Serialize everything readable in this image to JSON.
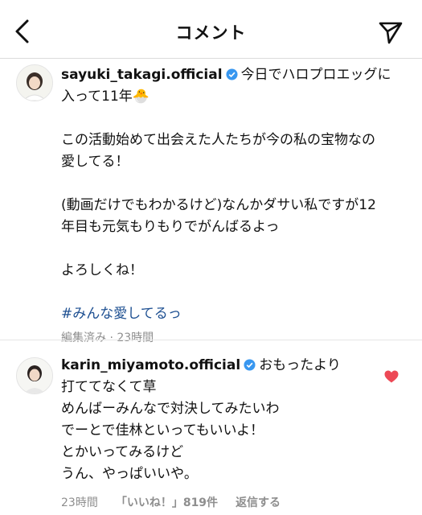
{
  "header": {
    "title": "コメント",
    "back_icon": "chevron-left-icon",
    "send_icon": "paper-plane-icon"
  },
  "comments": [
    {
      "username": "sayuki_takagi.official",
      "verified": true,
      "lines": [
        "今日でハロプロエッグに",
        "入って11年",
        "この活動始めて出会えた人たちが今の私の宝物なの",
        "愛してる！",
        "(動画だけでもわかるけど)なんかダサい私ですが12",
        "年目も元気もりもりでがんばるよっ",
        "よろしくね！"
      ],
      "emoji": "🐣",
      "hashtag": "#みんな愛してるっ",
      "meta": "編集済み · 23時間"
    },
    {
      "username": "karin_miyamoto.official",
      "verified": true,
      "lines": [
        "おもったより",
        "打ててなくて草",
        "めんばーみんなで対決してみたいわ",
        "でーとで佳林といってもいいよ！",
        "とかいってみるけど",
        "うん、やっぱいいや。"
      ],
      "meta_time": "23時間",
      "likes": "「いいね！」819件",
      "reply": "返信する",
      "liked": true,
      "heart_color": "#ed4956"
    }
  ],
  "colors": {
    "hashtag": "#1d4f91",
    "verified": "#3897f0",
    "muted": "#8e8e8e"
  }
}
